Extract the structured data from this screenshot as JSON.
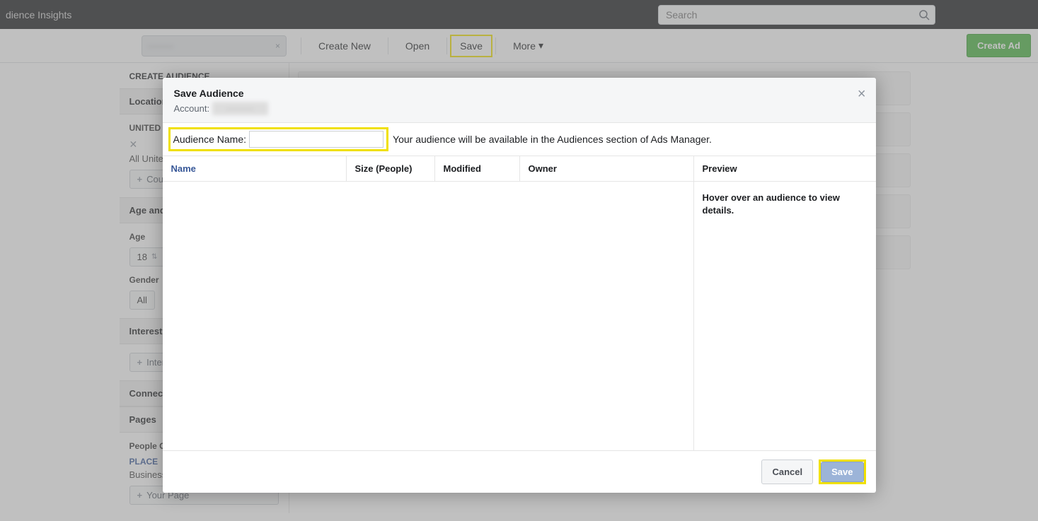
{
  "topbar": {
    "title": "dience Insights",
    "search_placeholder": "Search"
  },
  "toolbar": {
    "dropdown_text": "———",
    "create_new": "Create New",
    "open": "Open",
    "save": "Save",
    "more": "More",
    "create_ad": "Create Ad"
  },
  "sidebar": {
    "title": "CREATE AUDIENCE",
    "location_head": "Location",
    "country_label": "UNITED",
    "country_text": "All United",
    "add_country": "Cou",
    "age_gender_head": "Age and",
    "age_label": "Age",
    "age_value": "18",
    "gender_label": "Gender",
    "gender_value": "All",
    "interests_head": "Interests",
    "add_interest": "Inter",
    "connections_head": "Connect",
    "pages_subhead": "Pages",
    "people_label": "People C",
    "place_label": "PLACE",
    "business_label": "Business",
    "add_page": "Your Page"
  },
  "modal": {
    "title": "Save Audience",
    "account_label": "Account:",
    "account_value": "———",
    "name_label": "Audience Name:",
    "name_value": "",
    "hint": "Your audience will be available in the Audiences section of Ads Manager.",
    "columns": {
      "name": "Name",
      "size": "Size (People)",
      "modified": "Modified",
      "owner": "Owner",
      "preview": "Preview"
    },
    "preview_hint": "Hover over an audience to view details.",
    "cancel": "Cancel",
    "save": "Save"
  }
}
